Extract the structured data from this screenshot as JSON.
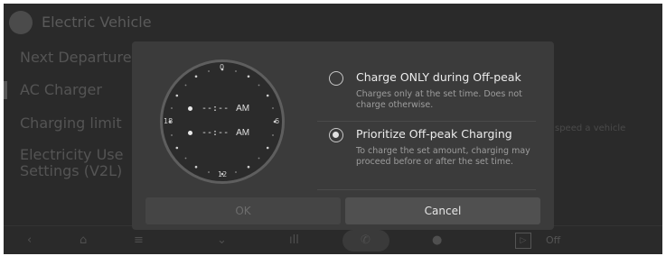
{
  "background": {
    "title": "Electric Vehicle",
    "menu": [
      "Next Departure",
      "AC Charger",
      "Charging limit",
      "Electricity Use",
      "Settings (V2L)"
    ],
    "right_text": "speed a vehicle",
    "nav": {
      "back": "‹",
      "home": "⌂",
      "menu": "≡",
      "chevron": "⌄",
      "signal": "ıll",
      "phone": "✆",
      "media": "●",
      "play": "▷",
      "off": "Off"
    }
  },
  "dialog": {
    "clock": {
      "top_label": "0",
      "left_label": "18",
      "right_label": "6",
      "bottom_label": "12",
      "start_time": "--:--",
      "start_ampm": "AM",
      "end_time": "--:--",
      "end_ampm": "AM"
    },
    "options": [
      {
        "title": "Charge ONLY during Off-peak",
        "description": "Charges only at the set time. Does not charge otherwise.",
        "selected": false
      },
      {
        "title": "Prioritize Off-peak Charging",
        "description": "To charge the set amount, charging may proceed before or after the set time.",
        "selected": true
      }
    ],
    "ok_label": "OK",
    "cancel_label": "Cancel"
  }
}
